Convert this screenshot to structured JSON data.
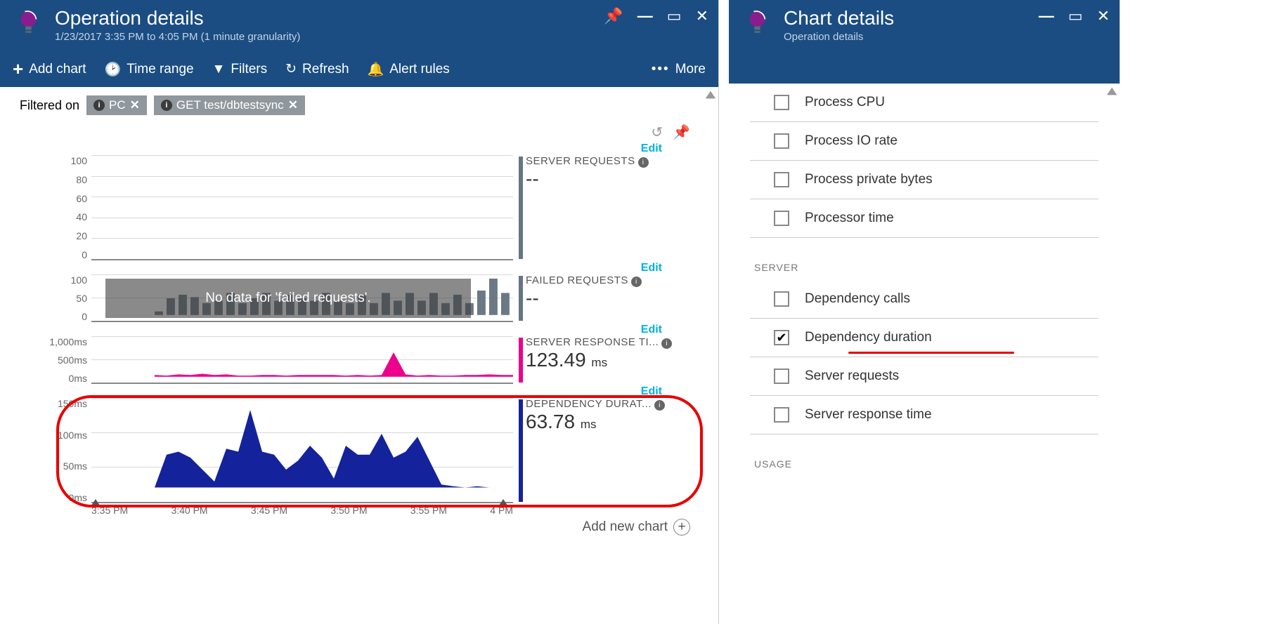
{
  "left": {
    "title": "Operation details",
    "subtitle": "1/23/2017 3:35 PM to 4:05 PM (1 minute granularity)",
    "toolbar": {
      "addChart": "Add chart",
      "timeRange": "Time range",
      "filters": "Filters",
      "refresh": "Refresh",
      "alertRules": "Alert rules",
      "more": "More"
    },
    "filterLabel": "Filtered on",
    "chips": [
      "PC",
      "GET test/dbtestsync"
    ],
    "editLabel": "Edit",
    "noDataMsg": "No data for 'failed requests'.",
    "metrics": [
      {
        "title": "SERVER REQUESTS",
        "value": "--",
        "unit": "",
        "color": "#647585"
      },
      {
        "title": "FAILED REQUESTS",
        "value": "--",
        "unit": "",
        "color": "#647585"
      },
      {
        "title": "SERVER RESPONSE TI...",
        "value": "123.49",
        "unit": "ms",
        "color": "#ec008c"
      },
      {
        "title": "DEPENDENCY DURAT...",
        "value": "63.78",
        "unit": "ms",
        "color": "#1b2f9c"
      }
    ],
    "xTicks": [
      "3:35 PM",
      "3:40 PM",
      "3:45 PM",
      "3:50 PM",
      "3:55 PM",
      "4 PM"
    ],
    "addNew": "Add new chart"
  },
  "right": {
    "title": "Chart details",
    "subtitle": "Operation details",
    "items1": [
      "Process CPU",
      "Process IO rate",
      "Process private bytes",
      "Processor time"
    ],
    "section": "SERVER",
    "items2": [
      {
        "label": "Dependency calls",
        "checked": false
      },
      {
        "label": "Dependency duration",
        "checked": true
      },
      {
        "label": "Server requests",
        "checked": false
      },
      {
        "label": "Server response time",
        "checked": false
      }
    ],
    "section2": "USAGE"
  },
  "chart_data": [
    {
      "type": "bar",
      "title": "Server requests",
      "ylim": [
        0,
        100
      ],
      "yticks": [
        0,
        20,
        40,
        60,
        80,
        100
      ],
      "x_range": [
        "3:35 PM",
        "4:05 PM"
      ],
      "values": [
        0,
        0,
        0,
        0,
        0,
        0,
        0,
        0,
        0,
        0,
        0,
        0,
        0,
        0,
        0,
        0,
        0,
        0,
        0,
        0,
        0,
        0,
        0,
        0,
        0,
        0,
        0,
        0,
        0,
        0
      ]
    },
    {
      "type": "bar",
      "title": "Failed requests",
      "ylim": [
        0,
        100
      ],
      "yticks": [
        0,
        50,
        100
      ],
      "x_range": [
        "3:35 PM",
        "4:05 PM"
      ],
      "note": "No data for 'failed requests'.",
      "values": [
        5,
        40,
        50,
        45,
        30,
        35,
        55,
        30,
        40,
        55,
        35,
        50,
        40,
        35,
        55,
        35,
        30,
        50,
        30,
        55,
        35,
        55,
        35,
        55,
        30,
        50,
        30,
        60,
        90,
        55
      ]
    },
    {
      "type": "area",
      "title": "Server response time",
      "ylim": [
        0,
        1000
      ],
      "yticks": [
        "0ms",
        "500ms",
        "1,000ms"
      ],
      "unit": "ms",
      "x_range": [
        "3:35 PM",
        "4:05 PM"
      ],
      "values": [
        40,
        30,
        50,
        35,
        55,
        35,
        50,
        30,
        25,
        35,
        40,
        30,
        40,
        35,
        40,
        35,
        30,
        35,
        30,
        35,
        600,
        50,
        30,
        35,
        25,
        30,
        40,
        45,
        60,
        40
      ]
    },
    {
      "type": "area",
      "title": "Dependency duration",
      "ylim": [
        0,
        150
      ],
      "yticks": [
        "0ms",
        "50ms",
        "100ms",
        "150ms"
      ],
      "unit": "ms",
      "x_range": [
        "3:35 PM",
        "4:05 PM"
      ],
      "values": [
        0,
        55,
        60,
        50,
        30,
        10,
        65,
        60,
        130,
        60,
        55,
        30,
        45,
        70,
        50,
        15,
        70,
        55,
        55,
        90,
        50,
        60,
        85,
        45,
        5,
        2,
        0,
        2,
        0,
        0
      ]
    }
  ]
}
